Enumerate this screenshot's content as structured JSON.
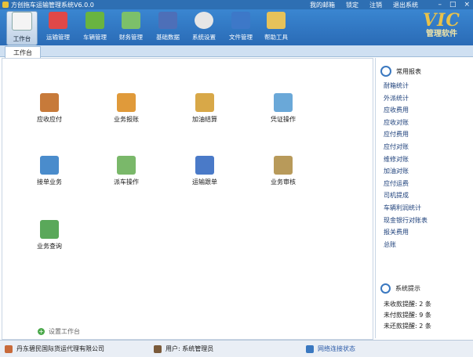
{
  "window": {
    "title": "方创拖车运输管理系统V6.0.0"
  },
  "top_links": [
    "我的邮箱",
    "锁定",
    "注销",
    "退出系统"
  ],
  "window_controls": [
    "–",
    "□",
    "×"
  ],
  "toolbar": [
    {
      "label": "工作台",
      "icon": "desk-icon",
      "color": "#f6f6f6",
      "active": true
    },
    {
      "label": "运输管理",
      "icon": "truck-icon",
      "color": "#e04848"
    },
    {
      "label": "车辆管理",
      "icon": "vehicle-icon",
      "color": "#69b440"
    },
    {
      "label": "财务管理",
      "icon": "money-icon",
      "color": "#7cc06a"
    },
    {
      "label": "基础数据",
      "icon": "database-icon",
      "color": "#4d6fb8"
    },
    {
      "label": "系统设置",
      "icon": "gear-icon",
      "color": "#e8e8e8"
    },
    {
      "label": "文件管理",
      "icon": "folder-icon",
      "color": "#3d78c8"
    },
    {
      "label": "帮助工具",
      "icon": "tools-icon",
      "color": "#e6c25a"
    }
  ],
  "logo": {
    "big": "VIC",
    "small": "管理软件"
  },
  "tab": {
    "label": "工作台"
  },
  "modules": [
    {
      "label": "应收应付",
      "icon": "ledger-icon",
      "color": "#c77a3a"
    },
    {
      "label": "业务报账",
      "icon": "calculator-icon",
      "color": "#e09a3a"
    },
    {
      "label": "加油结算",
      "icon": "fuel-icon",
      "color": "#d8a848"
    },
    {
      "label": "凭证操作",
      "icon": "voucher-icon",
      "color": "#6aa8d8"
    },
    {
      "label": "接单业务",
      "icon": "order-icon",
      "color": "#4a8ccc"
    },
    {
      "label": "派车操作",
      "icon": "dispatch-icon",
      "color": "#7ab86a"
    },
    {
      "label": "运输跟单",
      "icon": "tracking-icon",
      "color": "#4a7ac8"
    },
    {
      "label": "业务审核",
      "icon": "audit-icon",
      "color": "#b89a5a"
    },
    {
      "label": "业务查询",
      "icon": "query-icon",
      "color": "#5aa85a"
    }
  ],
  "settings_link": "设置工作台",
  "sidebar": {
    "title": "常用报表",
    "items": [
      "耐箱统计",
      "外派统计",
      "应收费用",
      "应收对账",
      "应付费用",
      "应付对账",
      "维修对账",
      "加油对账",
      "应付运费",
      "司机提成",
      "车辆利润统计",
      "现金银行对账表",
      "报关费用",
      "总账"
    ],
    "notice_title": "系统提示",
    "notices": [
      {
        "text": "未收款提醒: 2 条"
      },
      {
        "text": "未付款提醒: 9 条"
      },
      {
        "text": "未还款提醒: 2 条"
      }
    ]
  },
  "status": {
    "company": "丹东碧民国际货运代理有限公司",
    "user": "用户: 系统管理员",
    "network": "网络连接状态"
  }
}
